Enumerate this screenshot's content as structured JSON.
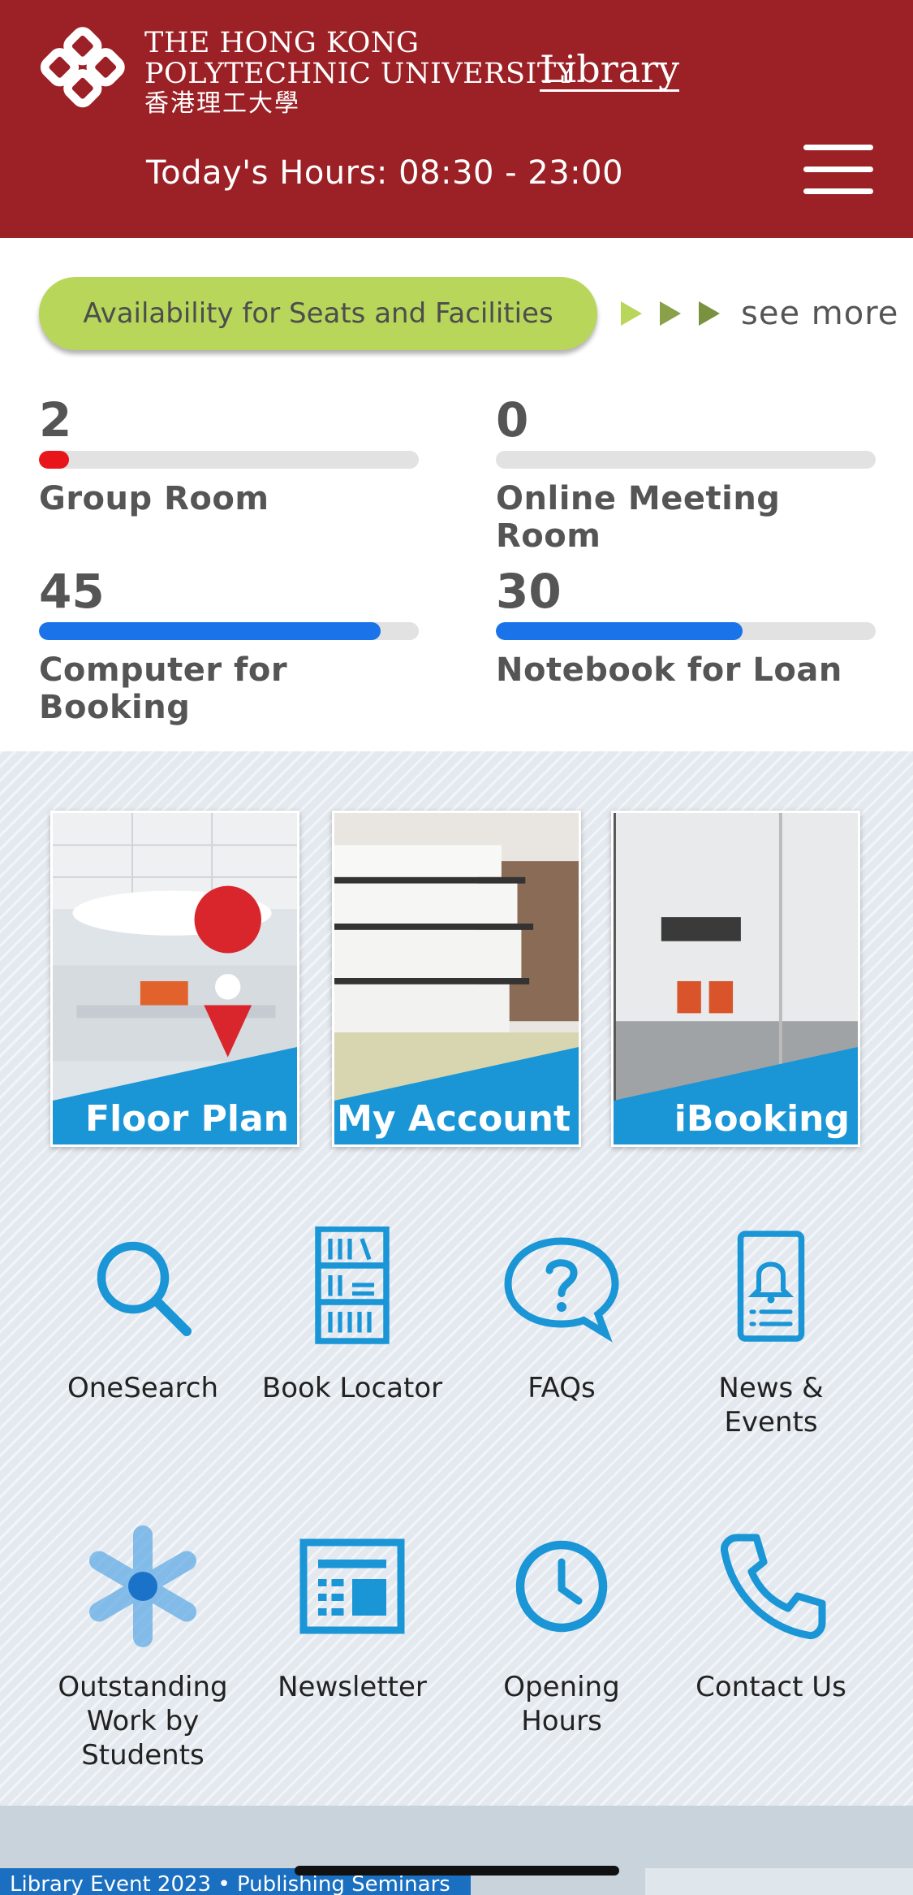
{
  "header": {
    "logo_line1": "THE HONG KONG",
    "logo_line2": "POLYTECHNIC UNIVERSITY",
    "logo_line3": "香港理工大學",
    "logo_library": "Library",
    "hours_text": "Today's Hours: 08:30 - 23:00"
  },
  "availability": {
    "title": "Availability for Seats and Facilities",
    "see_more": "see more",
    "stats": [
      {
        "count": "2",
        "label": "Group Room",
        "fill_fraction": 0.08,
        "color": "#e8151b"
      },
      {
        "count": "0",
        "label": "Online Meeting Room",
        "fill_fraction": 0.0,
        "color": "#1a73e8"
      },
      {
        "count": "45",
        "label": "Computer for Booking",
        "fill_fraction": 0.9,
        "color": "#1a73e8"
      },
      {
        "count": "30",
        "label": "Notebook for Loan",
        "fill_fraction": 0.65,
        "color": "#1a73e8"
      }
    ]
  },
  "tiles": [
    {
      "label": "Floor Plan"
    },
    {
      "label": "My Account"
    },
    {
      "label": "iBooking"
    }
  ],
  "icons_row1": [
    {
      "label": "OneSearch",
      "icon": "search-icon"
    },
    {
      "label": "Book Locator",
      "icon": "bookshelf-icon"
    },
    {
      "label": "FAQs",
      "icon": "question-bubble-icon"
    },
    {
      "label": "News & Events",
      "icon": "bell-notice-icon"
    }
  ],
  "icons_row2": [
    {
      "label": "Outstanding Work by Students",
      "icon": "star-asterisk-icon"
    },
    {
      "label": "Newsletter",
      "icon": "newsletter-icon"
    },
    {
      "label": "Opening Hours",
      "icon": "clock-icon"
    },
    {
      "label": "Contact Us",
      "icon": "phone-icon"
    }
  ],
  "banner": {
    "text": "Library Event 2023 • Publishing Seminars"
  },
  "colors": {
    "brand": "#9c2126",
    "accent": "#1a95d6",
    "green": "#b8d65a"
  }
}
